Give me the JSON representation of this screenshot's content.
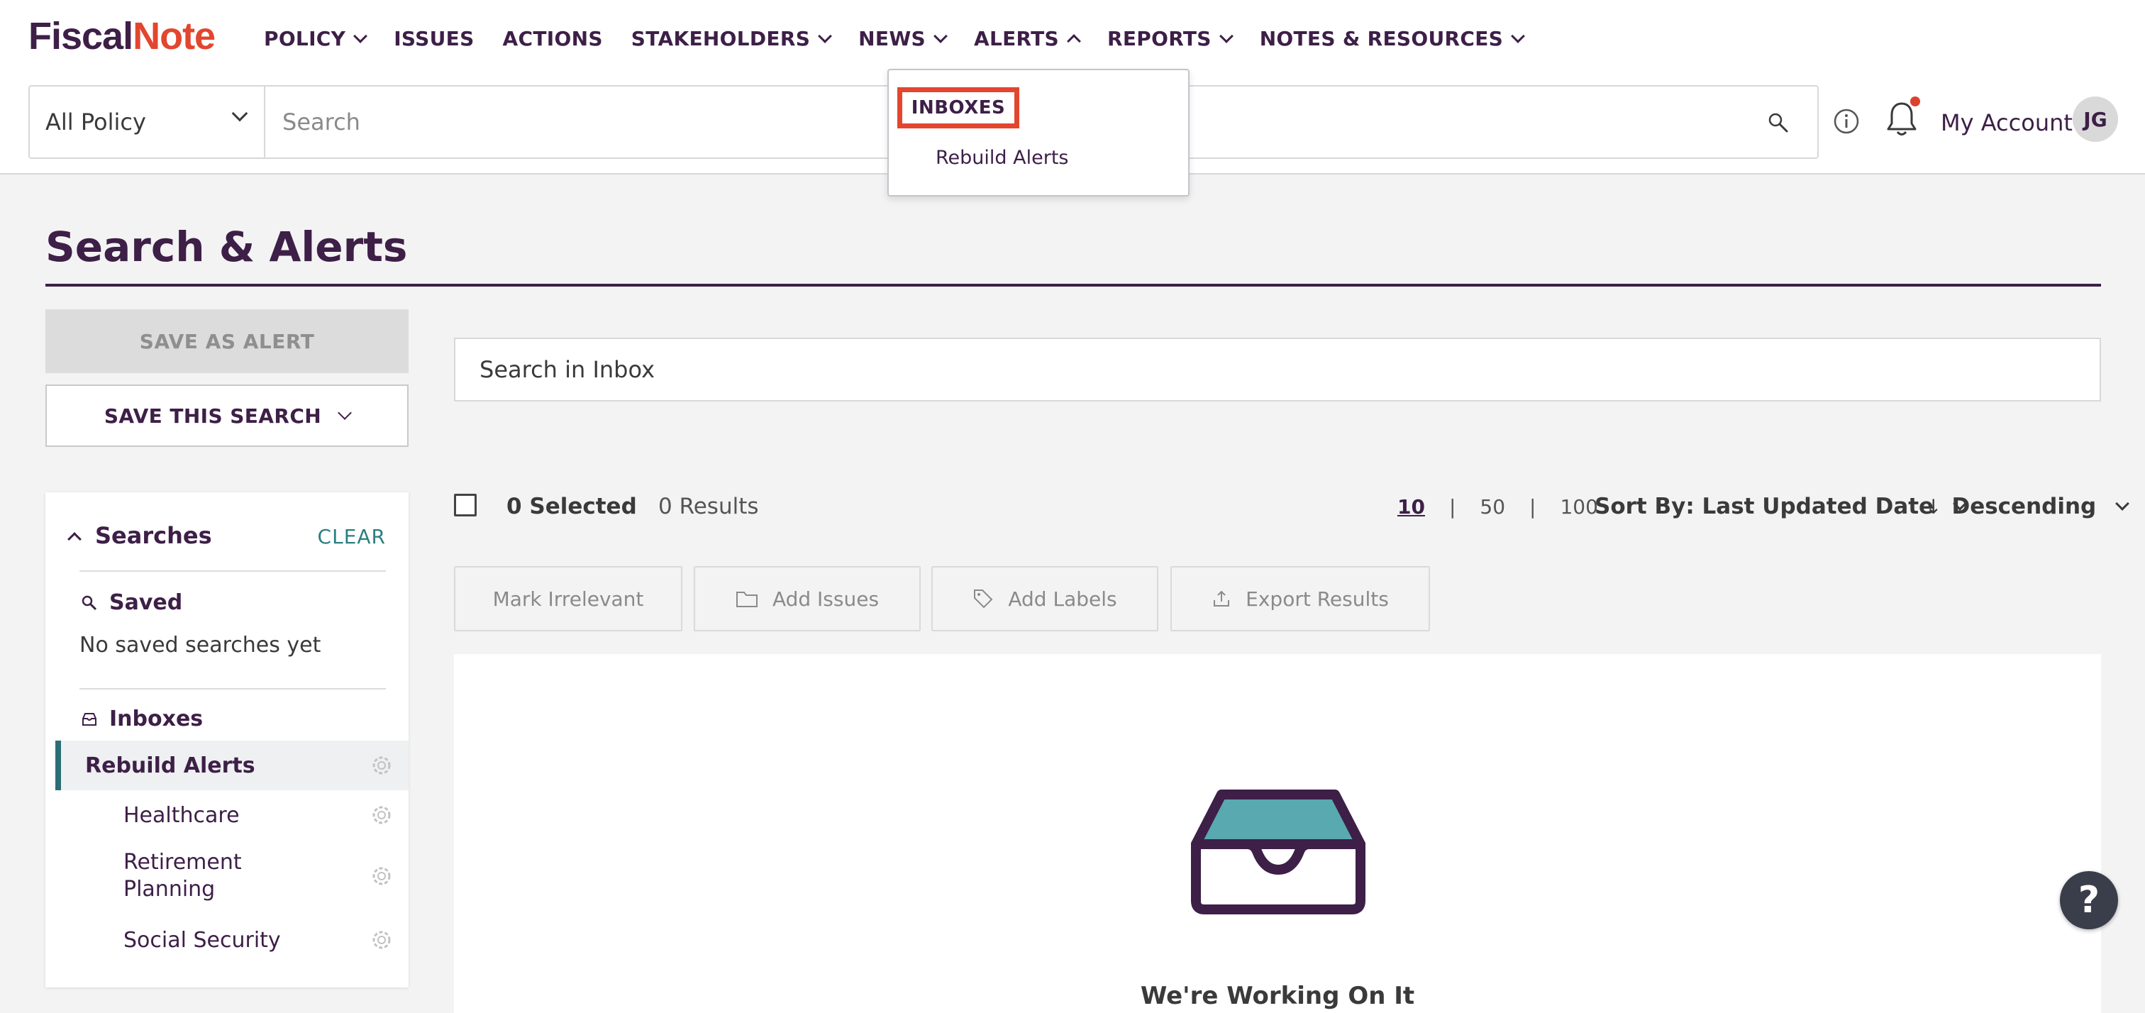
{
  "app": {
    "logo_part1": "Fiscal",
    "logo_part2": "Note"
  },
  "nav": {
    "items": [
      {
        "label": "POLICY",
        "has_menu": true
      },
      {
        "label": "ISSUES",
        "has_menu": false
      },
      {
        "label": "ACTIONS",
        "has_menu": false
      },
      {
        "label": "STAKEHOLDERS",
        "has_menu": true
      },
      {
        "label": "NEWS",
        "has_menu": true
      },
      {
        "label": "ALERTS",
        "has_menu": true,
        "expanded": true
      },
      {
        "label": "REPORTS",
        "has_menu": true
      },
      {
        "label": "NOTES & RESOURCES",
        "has_menu": true
      }
    ],
    "alerts_dropdown": {
      "header": "INBOXES",
      "items": [
        "Rebuild Alerts"
      ]
    }
  },
  "search": {
    "scope": "All Policy",
    "placeholder": "Search"
  },
  "account": {
    "label": "My Account",
    "initials": "JG",
    "has_notification": true
  },
  "page": {
    "title": "Search & Alerts"
  },
  "left": {
    "save_alert": "SAVE AS ALERT",
    "save_search": "SAVE THIS SEARCH",
    "panel_title": "Searches",
    "clear": "CLEAR",
    "saved_label": "Saved",
    "saved_empty": "No saved searches yet",
    "inboxes_label": "Inboxes",
    "inboxes": [
      {
        "name": "Rebuild Alerts",
        "active": true
      },
      {
        "name": "Healthcare",
        "active": false
      },
      {
        "name": "Retirement Planning",
        "active": false
      },
      {
        "name": "Social Security",
        "active": false
      }
    ]
  },
  "main": {
    "inbox_search_placeholder": "Search in Inbox",
    "selected": "0 Selected",
    "results": "0 Results",
    "page_sizes": [
      "10",
      "50",
      "100"
    ],
    "current_page_size": "10",
    "sort": "Sort By: Last Updated Date",
    "order": "Descending",
    "actions": [
      "Mark Irrelevant",
      "Add Issues",
      "Add Labels",
      "Export Results"
    ],
    "empty_title": "We're Working On It"
  },
  "help": "?",
  "colors": {
    "brand_dark": "#3d1f47",
    "brand_accent": "#e2462f",
    "teal": "#2a7f80",
    "empty_icon_fill": "#58a9b0"
  }
}
